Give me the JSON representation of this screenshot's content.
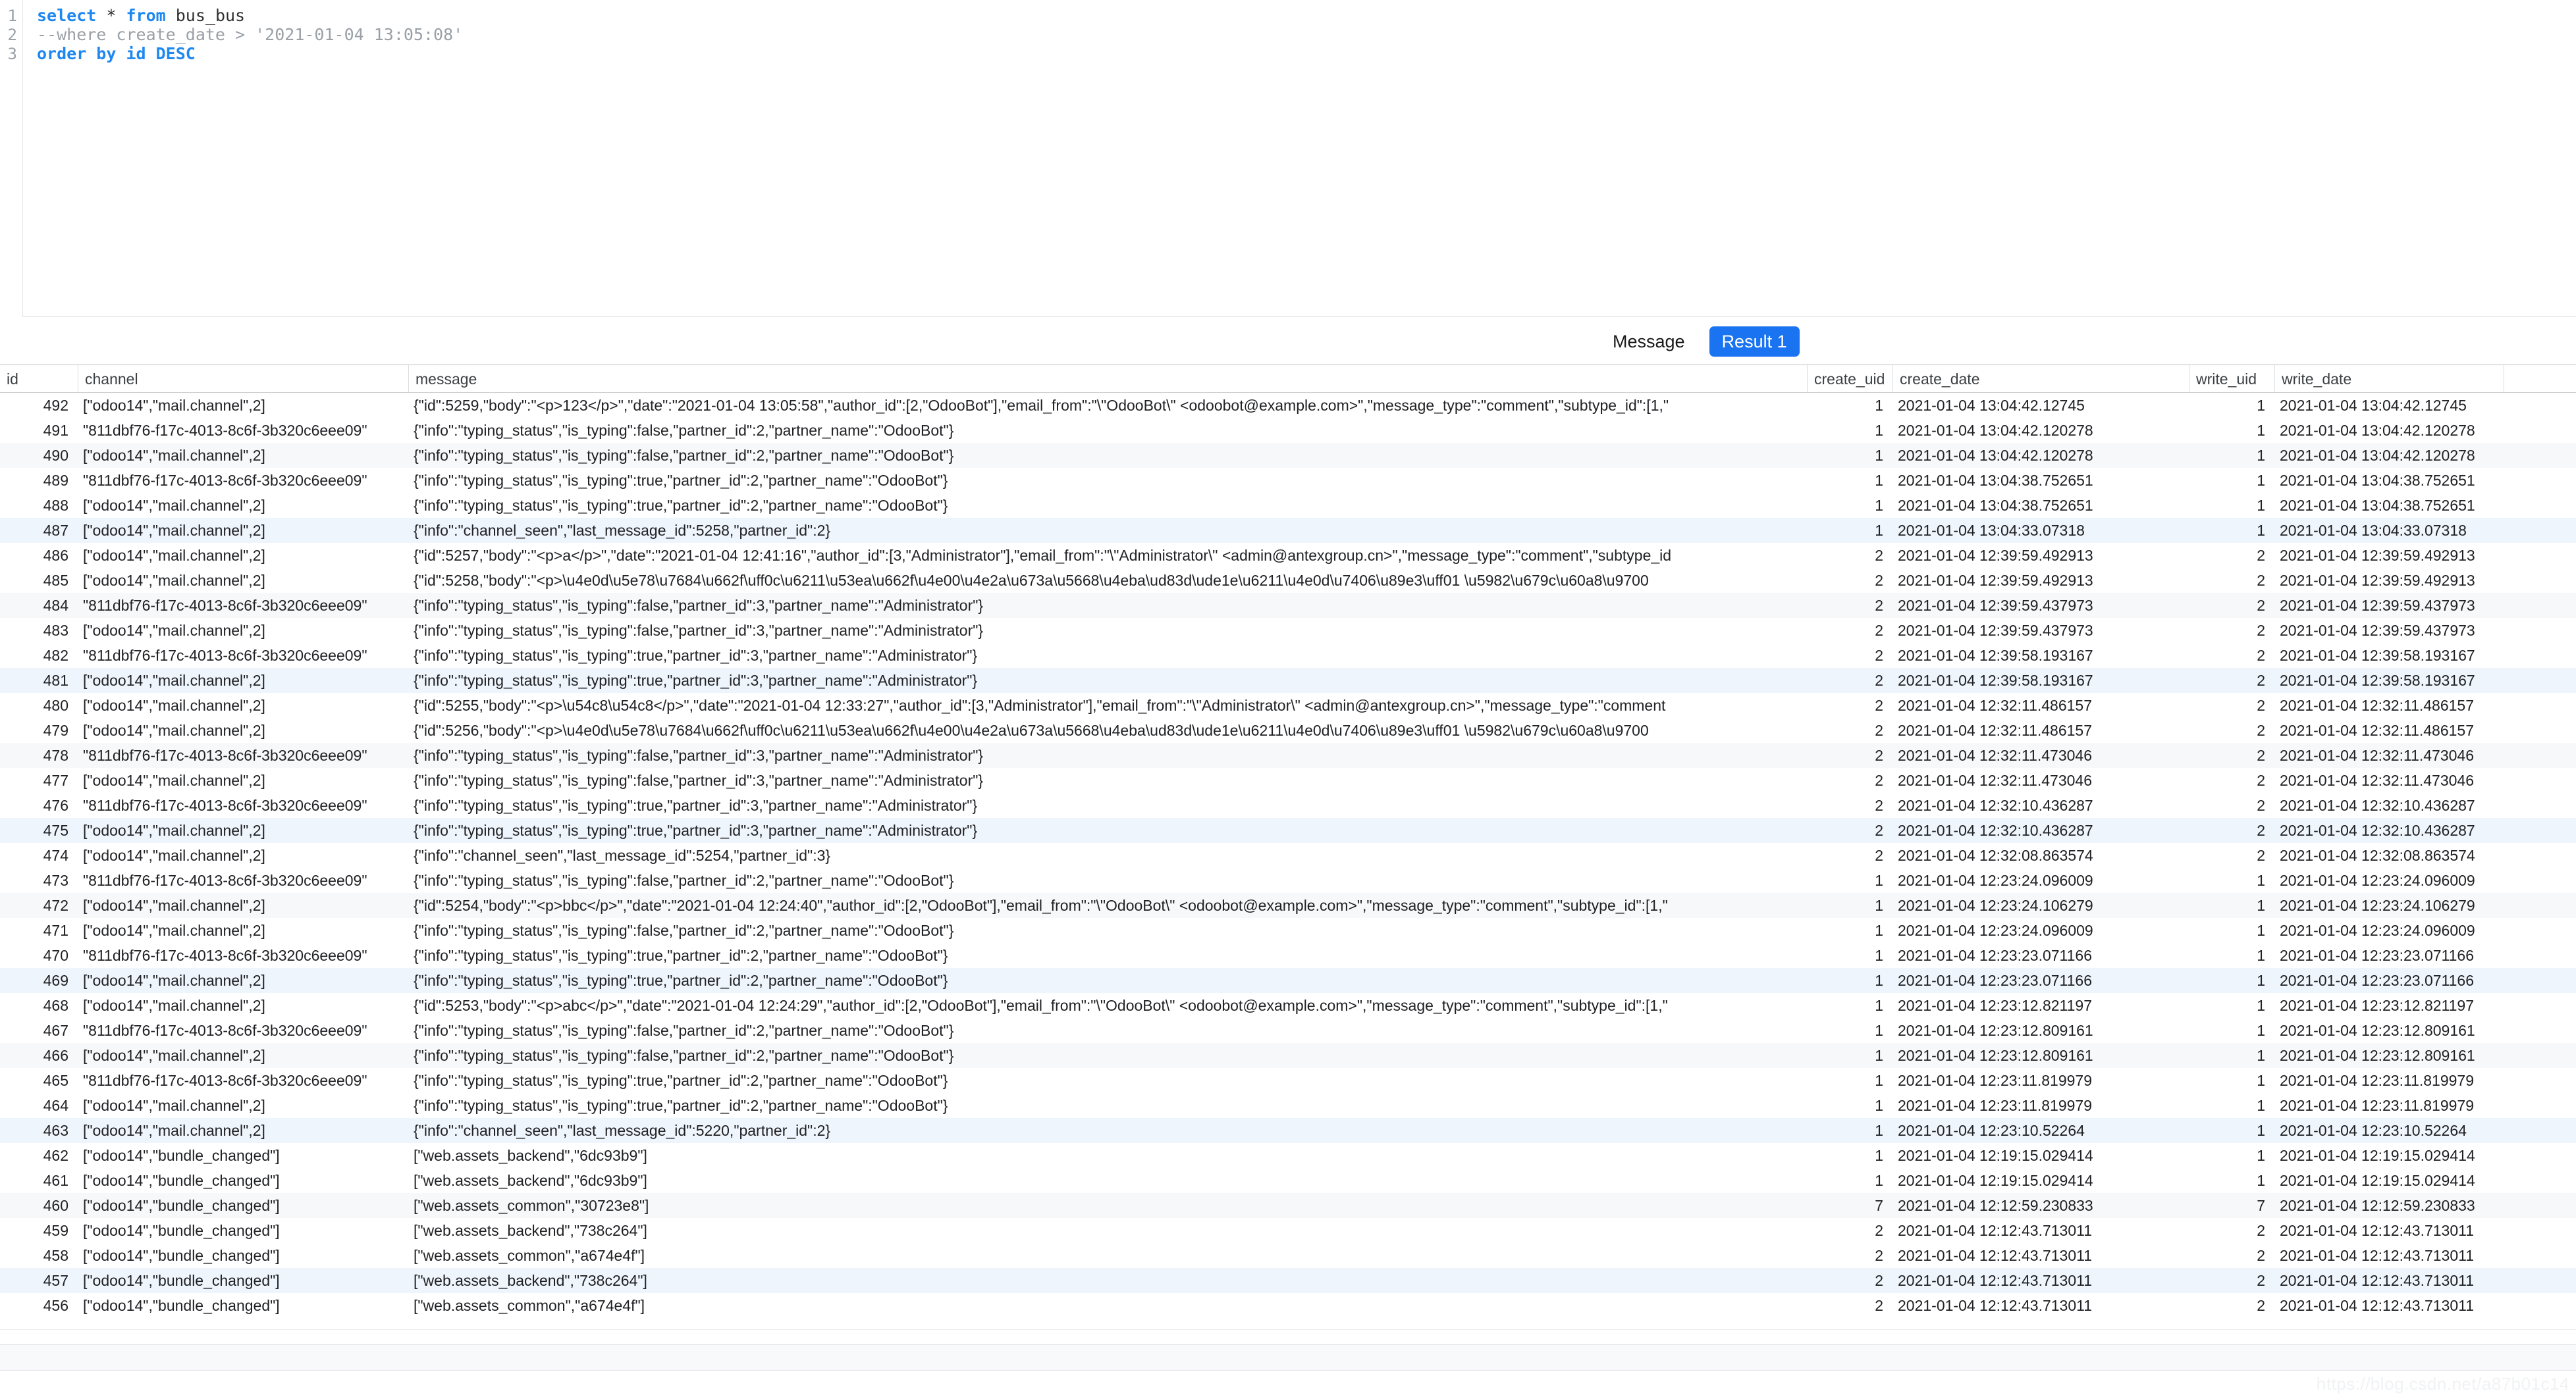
{
  "editor": {
    "lines": [
      {
        "number": "1",
        "segments": [
          {
            "text": "select ",
            "style": "kw"
          },
          {
            "text": "* ",
            "style": "plain"
          },
          {
            "text": "from ",
            "style": "kw"
          },
          {
            "text": "bus_bus",
            "style": "plain"
          }
        ]
      },
      {
        "number": "2",
        "segments": [
          {
            "text": "--where create_date > '2021-01-04 13:05:08'",
            "style": "cmt"
          }
        ]
      },
      {
        "number": "3",
        "segments": [
          {
            "text": "order by id DESC",
            "style": "kw"
          }
        ]
      }
    ]
  },
  "tabs": [
    {
      "label": "Message",
      "active": false
    },
    {
      "label": "Result 1",
      "active": true
    }
  ],
  "accent_color": "#1a73f0",
  "grid": {
    "columns": [
      "id",
      "channel",
      "message",
      "create_uid",
      "create_date",
      "write_uid",
      "write_date",
      ""
    ],
    "rows": [
      {
        "id": "492",
        "channel": "[\"odoo14\",\"mail.channel\",2]",
        "message": "{\"id\":5259,\"body\":\"<p>123</p>\",\"date\":\"2021-01-04 13:05:58\",\"author_id\":[2,\"OdooBot\"],\"email_from\":\"\\\"OdooBot\\\" <odoobot@example.com>\",\"message_type\":\"comment\",\"subtype_id\":[1,\"",
        "create_uid": "1",
        "create_date": "2021-01-04 13:04:42.12745",
        "write_uid": "1",
        "write_date": "2021-01-04 13:04:42.12745",
        "state": "normal"
      },
      {
        "id": "491",
        "channel": "\"811dbf76-f17c-4013-8c6f-3b320c6eee09\"",
        "message": "{\"info\":\"typing_status\",\"is_typing\":false,\"partner_id\":2,\"partner_name\":\"OdooBot\"}",
        "create_uid": "1",
        "create_date": "2021-01-04 13:04:42.120278",
        "write_uid": "1",
        "write_date": "2021-01-04 13:04:42.120278",
        "state": "normal"
      },
      {
        "id": "490",
        "channel": "[\"odoo14\",\"mail.channel\",2]",
        "message": "{\"info\":\"typing_status\",\"is_typing\":false,\"partner_id\":2,\"partner_name\":\"OdooBot\"}",
        "create_uid": "1",
        "create_date": "2021-01-04 13:04:42.120278",
        "write_uid": "1",
        "write_date": "2021-01-04 13:04:42.120278",
        "state": "alt"
      },
      {
        "id": "489",
        "channel": "\"811dbf76-f17c-4013-8c6f-3b320c6eee09\"",
        "message": "{\"info\":\"typing_status\",\"is_typing\":true,\"partner_id\":2,\"partner_name\":\"OdooBot\"}",
        "create_uid": "1",
        "create_date": "2021-01-04 13:04:38.752651",
        "write_uid": "1",
        "write_date": "2021-01-04 13:04:38.752651",
        "state": "normal"
      },
      {
        "id": "488",
        "channel": "[\"odoo14\",\"mail.channel\",2]",
        "message": "{\"info\":\"typing_status\",\"is_typing\":true,\"partner_id\":2,\"partner_name\":\"OdooBot\"}",
        "create_uid": "1",
        "create_date": "2021-01-04 13:04:38.752651",
        "write_uid": "1",
        "write_date": "2021-01-04 13:04:38.752651",
        "state": "normal"
      },
      {
        "id": "487",
        "channel": "[\"odoo14\",\"mail.channel\",2]",
        "message": "{\"info\":\"channel_seen\",\"last_message_id\":5258,\"partner_id\":2}",
        "create_uid": "1",
        "create_date": "2021-01-04 13:04:33.07318",
        "write_uid": "1",
        "write_date": "2021-01-04 13:04:33.07318",
        "state": "selected"
      },
      {
        "id": "486",
        "channel": "[\"odoo14\",\"mail.channel\",2]",
        "message": "{\"id\":5257,\"body\":\"<p>a</p>\",\"date\":\"2021-01-04 12:41:16\",\"author_id\":[3,\"Administrator\"],\"email_from\":\"\\\"Administrator\\\" <admin@antexgroup.cn>\",\"message_type\":\"comment\",\"subtype_id",
        "create_uid": "2",
        "create_date": "2021-01-04 12:39:59.492913",
        "write_uid": "2",
        "write_date": "2021-01-04 12:39:59.492913",
        "state": "normal"
      },
      {
        "id": "485",
        "channel": "[\"odoo14\",\"mail.channel\",2]",
        "message": "{\"id\":5258,\"body\":\"<p>\\u4e0d\\u5e78\\u7684\\u662f\\uff0c\\u6211\\u53ea\\u662f\\u4e00\\u4e2a\\u673a\\u5668\\u4eba\\ud83d\\ude1e\\u6211\\u4e0d\\u7406\\u89e3\\uff01 \\u5982\\u679c\\u60a8\\u9700",
        "create_uid": "2",
        "create_date": "2021-01-04 12:39:59.492913",
        "write_uid": "2",
        "write_date": "2021-01-04 12:39:59.492913",
        "state": "normal"
      },
      {
        "id": "484",
        "channel": "\"811dbf76-f17c-4013-8c6f-3b320c6eee09\"",
        "message": "{\"info\":\"typing_status\",\"is_typing\":false,\"partner_id\":3,\"partner_name\":\"Administrator\"}",
        "create_uid": "2",
        "create_date": "2021-01-04 12:39:59.437973",
        "write_uid": "2",
        "write_date": "2021-01-04 12:39:59.437973",
        "state": "alt"
      },
      {
        "id": "483",
        "channel": "[\"odoo14\",\"mail.channel\",2]",
        "message": "{\"info\":\"typing_status\",\"is_typing\":false,\"partner_id\":3,\"partner_name\":\"Administrator\"}",
        "create_uid": "2",
        "create_date": "2021-01-04 12:39:59.437973",
        "write_uid": "2",
        "write_date": "2021-01-04 12:39:59.437973",
        "state": "normal"
      },
      {
        "id": "482",
        "channel": "\"811dbf76-f17c-4013-8c6f-3b320c6eee09\"",
        "message": "{\"info\":\"typing_status\",\"is_typing\":true,\"partner_id\":3,\"partner_name\":\"Administrator\"}",
        "create_uid": "2",
        "create_date": "2021-01-04 12:39:58.193167",
        "write_uid": "2",
        "write_date": "2021-01-04 12:39:58.193167",
        "state": "normal"
      },
      {
        "id": "481",
        "channel": "[\"odoo14\",\"mail.channel\",2]",
        "message": "{\"info\":\"typing_status\",\"is_typing\":true,\"partner_id\":3,\"partner_name\":\"Administrator\"}",
        "create_uid": "2",
        "create_date": "2021-01-04 12:39:58.193167",
        "write_uid": "2",
        "write_date": "2021-01-04 12:39:58.193167",
        "state": "selected"
      },
      {
        "id": "480",
        "channel": "[\"odoo14\",\"mail.channel\",2]",
        "message": "{\"id\":5255,\"body\":\"<p>\\u54c8\\u54c8</p>\",\"date\":\"2021-01-04 12:33:27\",\"author_id\":[3,\"Administrator\"],\"email_from\":\"\\\"Administrator\\\" <admin@antexgroup.cn>\",\"message_type\":\"comment",
        "create_uid": "2",
        "create_date": "2021-01-04 12:32:11.486157",
        "write_uid": "2",
        "write_date": "2021-01-04 12:32:11.486157",
        "state": "normal"
      },
      {
        "id": "479",
        "channel": "[\"odoo14\",\"mail.channel\",2]",
        "message": "{\"id\":5256,\"body\":\"<p>\\u4e0d\\u5e78\\u7684\\u662f\\uff0c\\u6211\\u53ea\\u662f\\u4e00\\u4e2a\\u673a\\u5668\\u4eba\\ud83d\\ude1e\\u6211\\u4e0d\\u7406\\u89e3\\uff01 \\u5982\\u679c\\u60a8\\u9700",
        "create_uid": "2",
        "create_date": "2021-01-04 12:32:11.486157",
        "write_uid": "2",
        "write_date": "2021-01-04 12:32:11.486157",
        "state": "normal"
      },
      {
        "id": "478",
        "channel": "\"811dbf76-f17c-4013-8c6f-3b320c6eee09\"",
        "message": "{\"info\":\"typing_status\",\"is_typing\":false,\"partner_id\":3,\"partner_name\":\"Administrator\"}",
        "create_uid": "2",
        "create_date": "2021-01-04 12:32:11.473046",
        "write_uid": "2",
        "write_date": "2021-01-04 12:32:11.473046",
        "state": "alt"
      },
      {
        "id": "477",
        "channel": "[\"odoo14\",\"mail.channel\",2]",
        "message": "{\"info\":\"typing_status\",\"is_typing\":false,\"partner_id\":3,\"partner_name\":\"Administrator\"}",
        "create_uid": "2",
        "create_date": "2021-01-04 12:32:11.473046",
        "write_uid": "2",
        "write_date": "2021-01-04 12:32:11.473046",
        "state": "normal"
      },
      {
        "id": "476",
        "channel": "\"811dbf76-f17c-4013-8c6f-3b320c6eee09\"",
        "message": "{\"info\":\"typing_status\",\"is_typing\":true,\"partner_id\":3,\"partner_name\":\"Administrator\"}",
        "create_uid": "2",
        "create_date": "2021-01-04 12:32:10.436287",
        "write_uid": "2",
        "write_date": "2021-01-04 12:32:10.436287",
        "state": "normal"
      },
      {
        "id": "475",
        "channel": "[\"odoo14\",\"mail.channel\",2]",
        "message": "{\"info\":\"typing_status\",\"is_typing\":true,\"partner_id\":3,\"partner_name\":\"Administrator\"}",
        "create_uid": "2",
        "create_date": "2021-01-04 12:32:10.436287",
        "write_uid": "2",
        "write_date": "2021-01-04 12:32:10.436287",
        "state": "selected"
      },
      {
        "id": "474",
        "channel": "[\"odoo14\",\"mail.channel\",2]",
        "message": "{\"info\":\"channel_seen\",\"last_message_id\":5254,\"partner_id\":3}",
        "create_uid": "2",
        "create_date": "2021-01-04 12:32:08.863574",
        "write_uid": "2",
        "write_date": "2021-01-04 12:32:08.863574",
        "state": "normal"
      },
      {
        "id": "473",
        "channel": "\"811dbf76-f17c-4013-8c6f-3b320c6eee09\"",
        "message": "{\"info\":\"typing_status\",\"is_typing\":false,\"partner_id\":2,\"partner_name\":\"OdooBot\"}",
        "create_uid": "1",
        "create_date": "2021-01-04 12:23:24.096009",
        "write_uid": "1",
        "write_date": "2021-01-04 12:23:24.096009",
        "state": "normal"
      },
      {
        "id": "472",
        "channel": "[\"odoo14\",\"mail.channel\",2]",
        "message": "{\"id\":5254,\"body\":\"<p>bbc</p>\",\"date\":\"2021-01-04 12:24:40\",\"author_id\":[2,\"OdooBot\"],\"email_from\":\"\\\"OdooBot\\\" <odoobot@example.com>\",\"message_type\":\"comment\",\"subtype_id\":[1,\"",
        "create_uid": "1",
        "create_date": "2021-01-04 12:23:24.106279",
        "write_uid": "1",
        "write_date": "2021-01-04 12:23:24.106279",
        "state": "alt"
      },
      {
        "id": "471",
        "channel": "[\"odoo14\",\"mail.channel\",2]",
        "message": "{\"info\":\"typing_status\",\"is_typing\":false,\"partner_id\":2,\"partner_name\":\"OdooBot\"}",
        "create_uid": "1",
        "create_date": "2021-01-04 12:23:24.096009",
        "write_uid": "1",
        "write_date": "2021-01-04 12:23:24.096009",
        "state": "normal"
      },
      {
        "id": "470",
        "channel": "\"811dbf76-f17c-4013-8c6f-3b320c6eee09\"",
        "message": "{\"info\":\"typing_status\",\"is_typing\":true,\"partner_id\":2,\"partner_name\":\"OdooBot\"}",
        "create_uid": "1",
        "create_date": "2021-01-04 12:23:23.071166",
        "write_uid": "1",
        "write_date": "2021-01-04 12:23:23.071166",
        "state": "normal"
      },
      {
        "id": "469",
        "channel": "[\"odoo14\",\"mail.channel\",2]",
        "message": "{\"info\":\"typing_status\",\"is_typing\":true,\"partner_id\":2,\"partner_name\":\"OdooBot\"}",
        "create_uid": "1",
        "create_date": "2021-01-04 12:23:23.071166",
        "write_uid": "1",
        "write_date": "2021-01-04 12:23:23.071166",
        "state": "selected"
      },
      {
        "id": "468",
        "channel": "[\"odoo14\",\"mail.channel\",2]",
        "message": "{\"id\":5253,\"body\":\"<p>abc</p>\",\"date\":\"2021-01-04 12:24:29\",\"author_id\":[2,\"OdooBot\"],\"email_from\":\"\\\"OdooBot\\\" <odoobot@example.com>\",\"message_type\":\"comment\",\"subtype_id\":[1,\"",
        "create_uid": "1",
        "create_date": "2021-01-04 12:23:12.821197",
        "write_uid": "1",
        "write_date": "2021-01-04 12:23:12.821197",
        "state": "normal"
      },
      {
        "id": "467",
        "channel": "\"811dbf76-f17c-4013-8c6f-3b320c6eee09\"",
        "message": "{\"info\":\"typing_status\",\"is_typing\":false,\"partner_id\":2,\"partner_name\":\"OdooBot\"}",
        "create_uid": "1",
        "create_date": "2021-01-04 12:23:12.809161",
        "write_uid": "1",
        "write_date": "2021-01-04 12:23:12.809161",
        "state": "normal"
      },
      {
        "id": "466",
        "channel": "[\"odoo14\",\"mail.channel\",2]",
        "message": "{\"info\":\"typing_status\",\"is_typing\":false,\"partner_id\":2,\"partner_name\":\"OdooBot\"}",
        "create_uid": "1",
        "create_date": "2021-01-04 12:23:12.809161",
        "write_uid": "1",
        "write_date": "2021-01-04 12:23:12.809161",
        "state": "alt"
      },
      {
        "id": "465",
        "channel": "\"811dbf76-f17c-4013-8c6f-3b320c6eee09\"",
        "message": "{\"info\":\"typing_status\",\"is_typing\":true,\"partner_id\":2,\"partner_name\":\"OdooBot\"}",
        "create_uid": "1",
        "create_date": "2021-01-04 12:23:11.819979",
        "write_uid": "1",
        "write_date": "2021-01-04 12:23:11.819979",
        "state": "normal"
      },
      {
        "id": "464",
        "channel": "[\"odoo14\",\"mail.channel\",2]",
        "message": "{\"info\":\"typing_status\",\"is_typing\":true,\"partner_id\":2,\"partner_name\":\"OdooBot\"}",
        "create_uid": "1",
        "create_date": "2021-01-04 12:23:11.819979",
        "write_uid": "1",
        "write_date": "2021-01-04 12:23:11.819979",
        "state": "normal"
      },
      {
        "id": "463",
        "channel": "[\"odoo14\",\"mail.channel\",2]",
        "message": "{\"info\":\"channel_seen\",\"last_message_id\":5220,\"partner_id\":2}",
        "create_uid": "1",
        "create_date": "2021-01-04 12:23:10.52264",
        "write_uid": "1",
        "write_date": "2021-01-04 12:23:10.52264",
        "state": "selected"
      },
      {
        "id": "462",
        "channel": "[\"odoo14\",\"bundle_changed\"]",
        "message": "[\"web.assets_backend\",\"6dc93b9\"]",
        "create_uid": "1",
        "create_date": "2021-01-04 12:19:15.029414",
        "write_uid": "1",
        "write_date": "2021-01-04 12:19:15.029414",
        "state": "normal"
      },
      {
        "id": "461",
        "channel": "[\"odoo14\",\"bundle_changed\"]",
        "message": "[\"web.assets_backend\",\"6dc93b9\"]",
        "create_uid": "1",
        "create_date": "2021-01-04 12:19:15.029414",
        "write_uid": "1",
        "write_date": "2021-01-04 12:19:15.029414",
        "state": "normal"
      },
      {
        "id": "460",
        "channel": "[\"odoo14\",\"bundle_changed\"]",
        "message": "[\"web.assets_common\",\"30723e8\"]",
        "create_uid": "7",
        "create_date": "2021-01-04 12:12:59.230833",
        "write_uid": "7",
        "write_date": "2021-01-04 12:12:59.230833",
        "state": "alt"
      },
      {
        "id": "459",
        "channel": "[\"odoo14\",\"bundle_changed\"]",
        "message": "[\"web.assets_backend\",\"738c264\"]",
        "create_uid": "2",
        "create_date": "2021-01-04 12:12:43.713011",
        "write_uid": "2",
        "write_date": "2021-01-04 12:12:43.713011",
        "state": "normal"
      },
      {
        "id": "458",
        "channel": "[\"odoo14\",\"bundle_changed\"]",
        "message": "[\"web.assets_common\",\"a674e4f\"]",
        "create_uid": "2",
        "create_date": "2021-01-04 12:12:43.713011",
        "write_uid": "2",
        "write_date": "2021-01-04 12:12:43.713011",
        "state": "normal"
      },
      {
        "id": "457",
        "channel": "[\"odoo14\",\"bundle_changed\"]",
        "message": "[\"web.assets_backend\",\"738c264\"]",
        "create_uid": "2",
        "create_date": "2021-01-04 12:12:43.713011",
        "write_uid": "2",
        "write_date": "2021-01-04 12:12:43.713011",
        "state": "selected"
      },
      {
        "id": "456",
        "channel": "[\"odoo14\",\"bundle_changed\"]",
        "message": "[\"web.assets_common\",\"a674e4f\"]",
        "create_uid": "2",
        "create_date": "2021-01-04 12:12:43.713011",
        "write_uid": "2",
        "write_date": "2021-01-04 12:12:43.713011",
        "state": "normal"
      }
    ]
  },
  "watermark": "https://blog.csdn.net/a87b01c14"
}
